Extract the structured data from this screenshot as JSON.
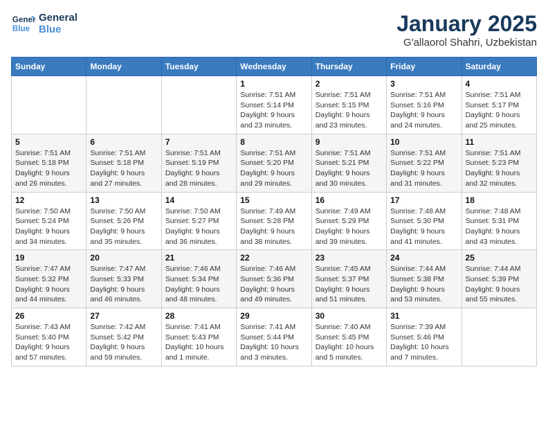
{
  "logo": {
    "line1": "General",
    "line2": "Blue"
  },
  "title": "January 2025",
  "subtitle": "G'allaorol Shahri, Uzbekistan",
  "weekdays": [
    "Sunday",
    "Monday",
    "Tuesday",
    "Wednesday",
    "Thursday",
    "Friday",
    "Saturday"
  ],
  "weeks": [
    [
      {
        "day": "",
        "info": ""
      },
      {
        "day": "",
        "info": ""
      },
      {
        "day": "",
        "info": ""
      },
      {
        "day": "1",
        "info": "Sunrise: 7:51 AM\nSunset: 5:14 PM\nDaylight: 9 hours and 23 minutes."
      },
      {
        "day": "2",
        "info": "Sunrise: 7:51 AM\nSunset: 5:15 PM\nDaylight: 9 hours and 23 minutes."
      },
      {
        "day": "3",
        "info": "Sunrise: 7:51 AM\nSunset: 5:16 PM\nDaylight: 9 hours and 24 minutes."
      },
      {
        "day": "4",
        "info": "Sunrise: 7:51 AM\nSunset: 5:17 PM\nDaylight: 9 hours and 25 minutes."
      }
    ],
    [
      {
        "day": "5",
        "info": "Sunrise: 7:51 AM\nSunset: 5:18 PM\nDaylight: 9 hours and 26 minutes."
      },
      {
        "day": "6",
        "info": "Sunrise: 7:51 AM\nSunset: 5:18 PM\nDaylight: 9 hours and 27 minutes."
      },
      {
        "day": "7",
        "info": "Sunrise: 7:51 AM\nSunset: 5:19 PM\nDaylight: 9 hours and 28 minutes."
      },
      {
        "day": "8",
        "info": "Sunrise: 7:51 AM\nSunset: 5:20 PM\nDaylight: 9 hours and 29 minutes."
      },
      {
        "day": "9",
        "info": "Sunrise: 7:51 AM\nSunset: 5:21 PM\nDaylight: 9 hours and 30 minutes."
      },
      {
        "day": "10",
        "info": "Sunrise: 7:51 AM\nSunset: 5:22 PM\nDaylight: 9 hours and 31 minutes."
      },
      {
        "day": "11",
        "info": "Sunrise: 7:51 AM\nSunset: 5:23 PM\nDaylight: 9 hours and 32 minutes."
      }
    ],
    [
      {
        "day": "12",
        "info": "Sunrise: 7:50 AM\nSunset: 5:24 PM\nDaylight: 9 hours and 34 minutes."
      },
      {
        "day": "13",
        "info": "Sunrise: 7:50 AM\nSunset: 5:26 PM\nDaylight: 9 hours and 35 minutes."
      },
      {
        "day": "14",
        "info": "Sunrise: 7:50 AM\nSunset: 5:27 PM\nDaylight: 9 hours and 36 minutes."
      },
      {
        "day": "15",
        "info": "Sunrise: 7:49 AM\nSunset: 5:28 PM\nDaylight: 9 hours and 38 minutes."
      },
      {
        "day": "16",
        "info": "Sunrise: 7:49 AM\nSunset: 5:29 PM\nDaylight: 9 hours and 39 minutes."
      },
      {
        "day": "17",
        "info": "Sunrise: 7:48 AM\nSunset: 5:30 PM\nDaylight: 9 hours and 41 minutes."
      },
      {
        "day": "18",
        "info": "Sunrise: 7:48 AM\nSunset: 5:31 PM\nDaylight: 9 hours and 43 minutes."
      }
    ],
    [
      {
        "day": "19",
        "info": "Sunrise: 7:47 AM\nSunset: 5:32 PM\nDaylight: 9 hours and 44 minutes."
      },
      {
        "day": "20",
        "info": "Sunrise: 7:47 AM\nSunset: 5:33 PM\nDaylight: 9 hours and 46 minutes."
      },
      {
        "day": "21",
        "info": "Sunrise: 7:46 AM\nSunset: 5:34 PM\nDaylight: 9 hours and 48 minutes."
      },
      {
        "day": "22",
        "info": "Sunrise: 7:46 AM\nSunset: 5:36 PM\nDaylight: 9 hours and 49 minutes."
      },
      {
        "day": "23",
        "info": "Sunrise: 7:45 AM\nSunset: 5:37 PM\nDaylight: 9 hours and 51 minutes."
      },
      {
        "day": "24",
        "info": "Sunrise: 7:44 AM\nSunset: 5:38 PM\nDaylight: 9 hours and 53 minutes."
      },
      {
        "day": "25",
        "info": "Sunrise: 7:44 AM\nSunset: 5:39 PM\nDaylight: 9 hours and 55 minutes."
      }
    ],
    [
      {
        "day": "26",
        "info": "Sunrise: 7:43 AM\nSunset: 5:40 PM\nDaylight: 9 hours and 57 minutes."
      },
      {
        "day": "27",
        "info": "Sunrise: 7:42 AM\nSunset: 5:42 PM\nDaylight: 9 hours and 59 minutes."
      },
      {
        "day": "28",
        "info": "Sunrise: 7:41 AM\nSunset: 5:43 PM\nDaylight: 10 hours and 1 minute."
      },
      {
        "day": "29",
        "info": "Sunrise: 7:41 AM\nSunset: 5:44 PM\nDaylight: 10 hours and 3 minutes."
      },
      {
        "day": "30",
        "info": "Sunrise: 7:40 AM\nSunset: 5:45 PM\nDaylight: 10 hours and 5 minutes."
      },
      {
        "day": "31",
        "info": "Sunrise: 7:39 AM\nSunset: 5:46 PM\nDaylight: 10 hours and 7 minutes."
      },
      {
        "day": "",
        "info": ""
      }
    ]
  ]
}
